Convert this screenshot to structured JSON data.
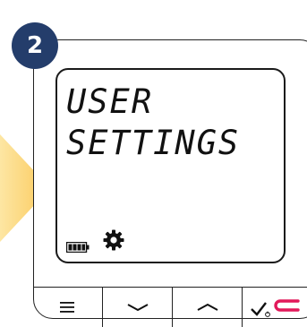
{
  "step": {
    "number": "2"
  },
  "screen": {
    "line1": "USER",
    "line2": "SETTINGS",
    "battery_icon": "battery-full-icon",
    "settings_icon": "gear-icon"
  },
  "buttons": [
    {
      "icon": "menu-icon"
    },
    {
      "icon": "chevron-down-icon"
    },
    {
      "icon": "chevron-up-icon"
    },
    {
      "icon": "confirm-power-icon"
    }
  ],
  "colors": {
    "badge": "#243d6b",
    "arrow": "#fcd068",
    "accent": "#e2195a"
  }
}
